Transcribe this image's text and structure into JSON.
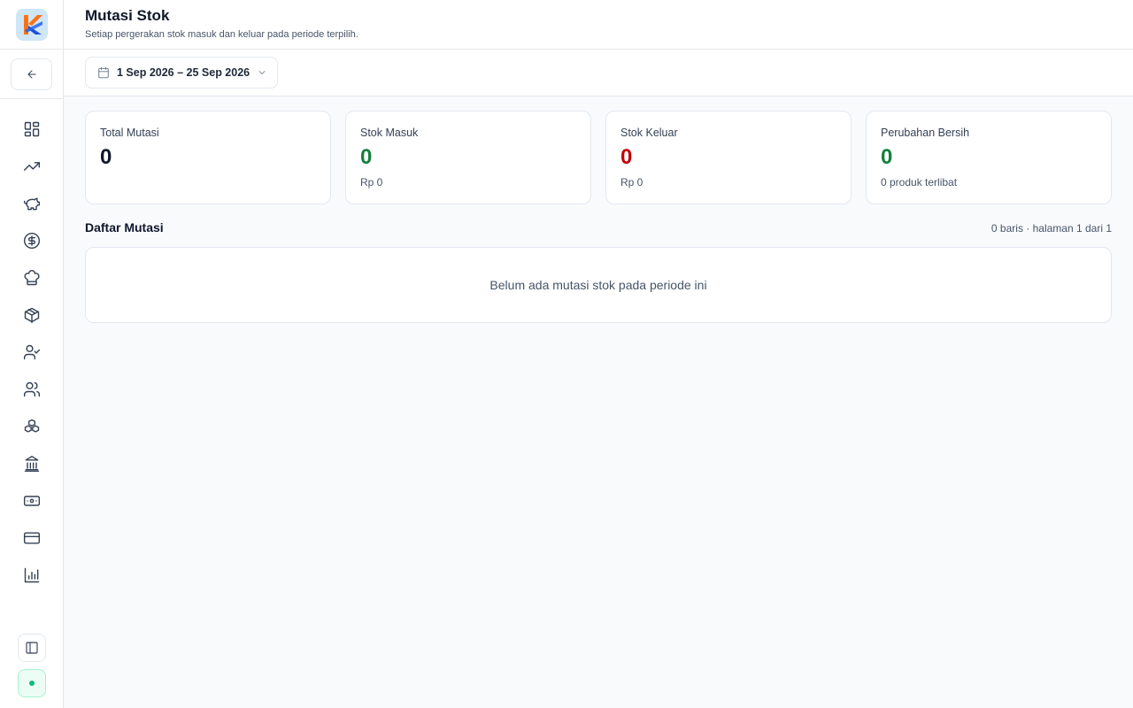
{
  "header": {
    "title": "Mutasi Stok",
    "subtitle": "Setiap pergerakan stok masuk dan keluar pada periode terpilih."
  },
  "toolbar": {
    "date_range": "1 Sep 2026 – 25 Sep 2026"
  },
  "colors": {
    "positive": "#15803d",
    "negative": "#c10007",
    "logo_bg": "#cfe6f6",
    "logo_orange": "#f97316",
    "logo_blue": "#1d4ed8"
  },
  "sidebar": {
    "icons": [
      "back-arrow-icon",
      "dashboard-icon",
      "trending-up-icon",
      "piggy-bank-icon",
      "dollar-circle-icon",
      "chef-hat-icon",
      "package-icon",
      "user-check-icon",
      "users-icon",
      "boxes-icon",
      "bank-icon",
      "banknote-icon",
      "credit-card-icon",
      "bar-chart-icon",
      "sidebar-toggle-icon",
      "status-dot"
    ]
  },
  "cards": {
    "total": {
      "label": "Total Mutasi",
      "value": "0"
    },
    "masuk": {
      "label": "Stok Masuk",
      "value": "0",
      "sub": "Rp 0"
    },
    "keluar": {
      "label": "Stok Keluar",
      "value": "0",
      "sub": "Rp 0"
    },
    "bersih": {
      "label": "Perubahan Bersih",
      "value": "0",
      "sub": "0 produk terlibat"
    }
  },
  "list": {
    "title": "Daftar Mutasi",
    "meta": "0 baris · halaman 1 dari 1",
    "empty": "Belum ada mutasi stok pada periode ini"
  }
}
